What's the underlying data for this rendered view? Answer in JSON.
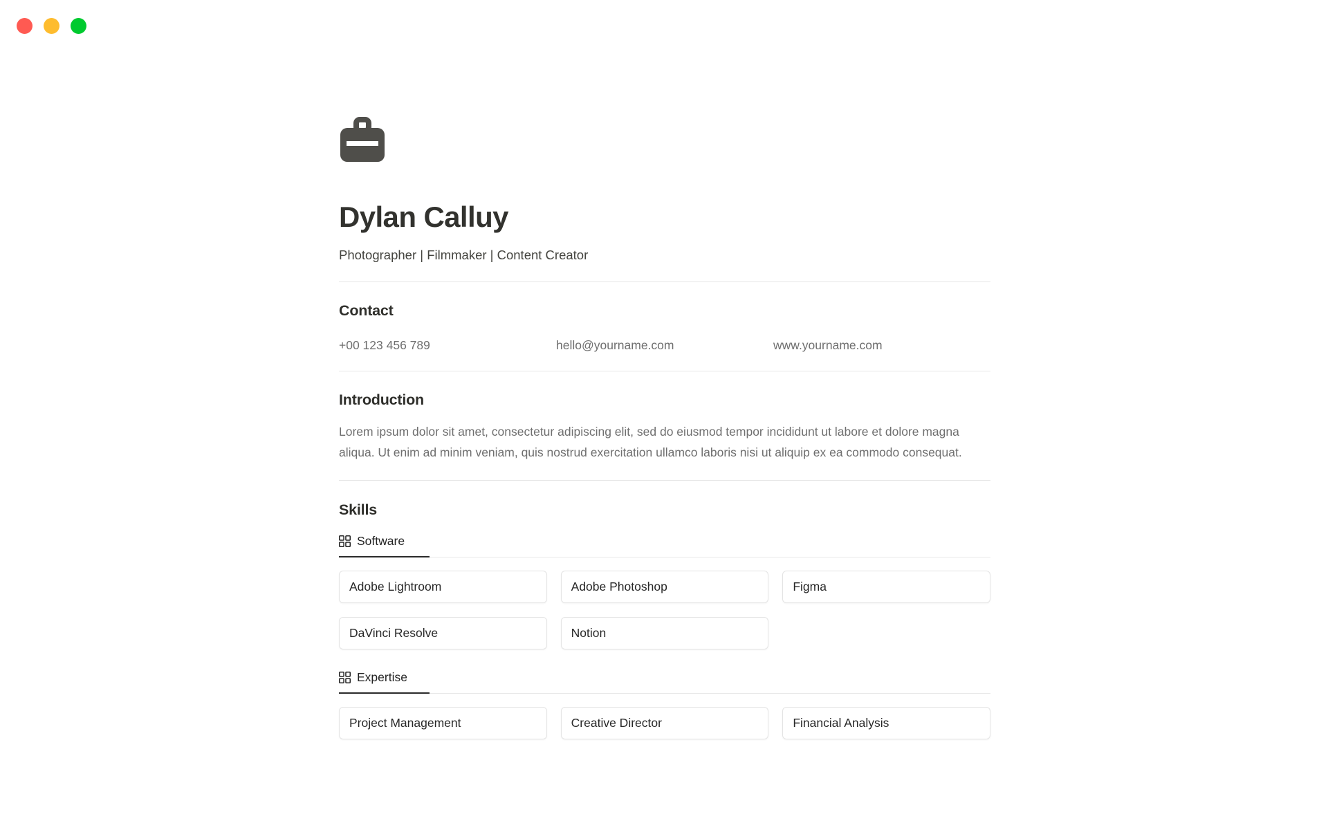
{
  "window": {
    "controls": [
      {
        "name": "close",
        "label": "Close",
        "color": "#ff5a52"
      },
      {
        "name": "minimize",
        "label": "Minimize",
        "color": "#febc2e"
      },
      {
        "name": "maximize",
        "label": "Maximize",
        "color": "#00ca2f"
      }
    ]
  },
  "header": {
    "avatar_icon": "briefcase-icon",
    "name": "Dylan Calluy",
    "tagline": "Photographer | Filmmaker | Content Creator"
  },
  "contact": {
    "heading": "Contact",
    "items": [
      {
        "type": "phone",
        "value": "+00 123 456 789"
      },
      {
        "type": "email",
        "value": "hello@yourname.com"
      },
      {
        "type": "website",
        "value": "www.yourname.com"
      }
    ]
  },
  "introduction": {
    "heading": "Introduction",
    "body": "Lorem ipsum dolor sit amet, consectetur adipiscing elit, sed do eiusmod tempor incididunt ut labore et dolore magna aliqua. Ut enim ad minim veniam, quis nostrud exercitation ullamco laboris nisi ut aliquip ex ea commodo consequat."
  },
  "skills": {
    "heading": "Skills",
    "groups": [
      {
        "tab_label": "Software",
        "tab_icon": "grid-icon",
        "active": true,
        "items": [
          "Adobe Lightroom",
          "Adobe Photoshop",
          "Figma",
          "DaVinci Resolve",
          "Notion"
        ]
      },
      {
        "tab_label": "Expertise",
        "tab_icon": "grid-icon",
        "active": true,
        "items": [
          "Project Management",
          "Creative Director",
          "Financial Analysis"
        ]
      }
    ]
  },
  "colors": {
    "text_primary": "#2f2f2b",
    "text_secondary": "#6f6f6f",
    "accent_underline": "#2a2a2a",
    "card_border": "#e4e4e4",
    "divider": "#e6e6e6",
    "icon_fill": "#4f4e4a"
  }
}
